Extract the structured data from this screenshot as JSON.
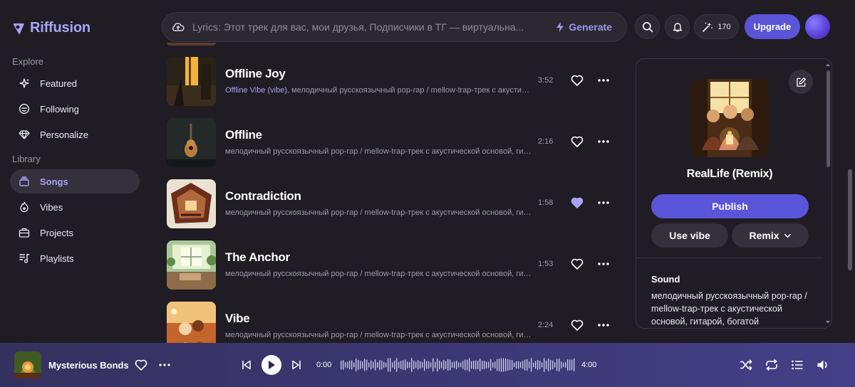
{
  "app": {
    "name": "Riffusion",
    "accent": "#5a54d8",
    "accent_light": "#a9a4f5"
  },
  "sidebar": {
    "explore_label": "Explore",
    "library_label": "Library",
    "explore_items": [
      {
        "label": "Featured",
        "icon": "sparkle-icon"
      },
      {
        "label": "Following",
        "icon": "smile-icon"
      },
      {
        "label": "Personalize",
        "icon": "diamond-icon"
      }
    ],
    "library_items": [
      {
        "label": "Songs",
        "icon": "songs-icon",
        "active": true
      },
      {
        "label": "Vibes",
        "icon": "vibe-icon"
      },
      {
        "label": "Projects",
        "icon": "briefcase-icon"
      },
      {
        "label": "Playlists",
        "icon": "playlist-icon"
      }
    ]
  },
  "topbar": {
    "lyrics_text": "Lyrics: Этот трек для вас, мои друзья, Подписчики в ТГ — виртуальна...",
    "generate_label": "Generate",
    "credits": "170",
    "upgrade_label": "Upgrade"
  },
  "songs": [
    {
      "title": "Offline Joy",
      "vibe": "Offline Vibe (vibe)",
      "desc": ", мелодичный русскоязычный pop-rap / mellow-trap-трек с акустической основой, гитарой",
      "duration": "3:52",
      "liked": false
    },
    {
      "title": "Offline",
      "vibe": "",
      "desc": "мелодичный русскоязычный pop-rap / mellow-trap-трек с акустической основой, гитарой",
      "duration": "2:16",
      "liked": false
    },
    {
      "title": "Contradiction",
      "vibe": "",
      "desc": "мелодичный русскоязычный pop-rap / mellow-trap-трек с акустической основой, гитарой",
      "duration": "1:58",
      "liked": true
    },
    {
      "title": "The Anchor",
      "vibe": "",
      "desc": "мелодичный русскоязычный pop-rap / mellow-trap-трек с акустической основой, гитарой",
      "duration": "1:53",
      "liked": false
    },
    {
      "title": "Vibe",
      "vibe": "",
      "desc": "мелодичный русскоязычный pop-rap / mellow-trap-трек с акустической основой, гитарой",
      "duration": "2:24",
      "liked": false
    }
  ],
  "panel": {
    "title": "RealLife (Remix)",
    "publish_label": "Publish",
    "use_vibe_label": "Use vibe",
    "remix_label": "Remix",
    "sound_label": "Sound",
    "sound_text": "мелодичный русскоязычный pop-rap / mellow-trap-трек с акустической основой, гитарой, богатой"
  },
  "player": {
    "title": "Mysterious Bonds",
    "current_time": "0:00",
    "total_time": "4:00",
    "progress": 0
  }
}
